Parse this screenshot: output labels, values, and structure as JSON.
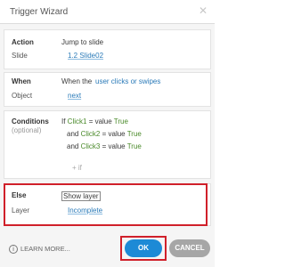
{
  "dialog": {
    "title": "Trigger Wizard"
  },
  "action": {
    "label": "Action",
    "value": "Jump to slide",
    "slide_label": "Slide",
    "slide_value": "1.2 Slide02"
  },
  "when": {
    "label": "When",
    "prefix": "When the",
    "event": "user clicks or swipes",
    "object_label": "Object",
    "object_value": "next"
  },
  "conditions": {
    "label": "Conditions",
    "sublabel": "(optional)",
    "rows": [
      {
        "connector": "If",
        "variable": "Click1",
        "op": "= value",
        "value": "True"
      },
      {
        "connector": "and",
        "variable": "Click2",
        "op": "= value",
        "value": "True"
      },
      {
        "connector": "and",
        "variable": "Click3",
        "op": "= value",
        "value": "True"
      }
    ],
    "add_label": "+ if"
  },
  "else": {
    "label": "Else",
    "value": "Show layer",
    "layer_label": "Layer",
    "layer_value": "Incomplete"
  },
  "footer": {
    "learn_more": "LEARN MORE...",
    "info_glyph": "i",
    "ok_label": "OK",
    "cancel_label": "CANCEL"
  },
  "colors": {
    "accent": "#1d8ad6",
    "highlight": "#d0202a"
  },
  "icons": {
    "close": "close-icon",
    "info": "info-icon"
  }
}
